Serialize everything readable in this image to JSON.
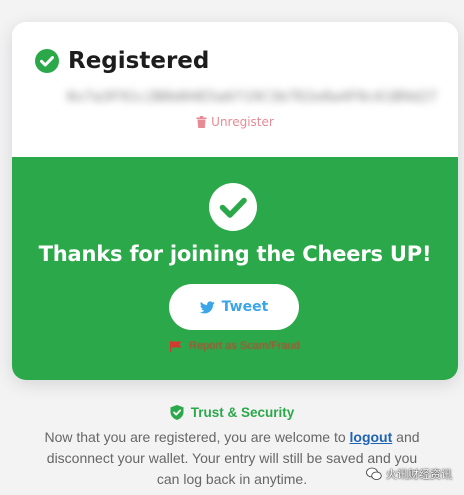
{
  "card": {
    "title": "Registered",
    "wallet_address": "0x7a3F91c2B8d04E5a6f19C3b7D2e8a4F0c61B9d27",
    "unregister_label": "Unregister"
  },
  "success": {
    "heading": "Thanks for joining the Cheers UP!",
    "tweet_label": "Tweet",
    "report_label": "Report as Scam/Fraud"
  },
  "security": {
    "title": "Trust & Security",
    "text_before_link": "Now that you are registered, you are welcome to ",
    "link_label": "logout",
    "text_after_link": " and disconnect your wallet. Your entry will still be saved and you can log back in anytime."
  },
  "watermark": {
    "label": "火讯财经资讯"
  },
  "colors": {
    "accent_green": "#2ba84a",
    "twitter_blue": "#3aa6e8",
    "unregister_pink": "#e88a94",
    "report_red": "#d13a2e",
    "link_blue": "#1f63b5"
  },
  "icons": {
    "title_icon": "check-circle-icon",
    "unregister_icon": "trash-icon",
    "success_icon": "check-circle-icon",
    "tweet_icon": "twitter-bird-icon",
    "report_icon": "flag-icon",
    "security_icon": "shield-check-icon",
    "watermark_icon": "wechat-icon"
  }
}
